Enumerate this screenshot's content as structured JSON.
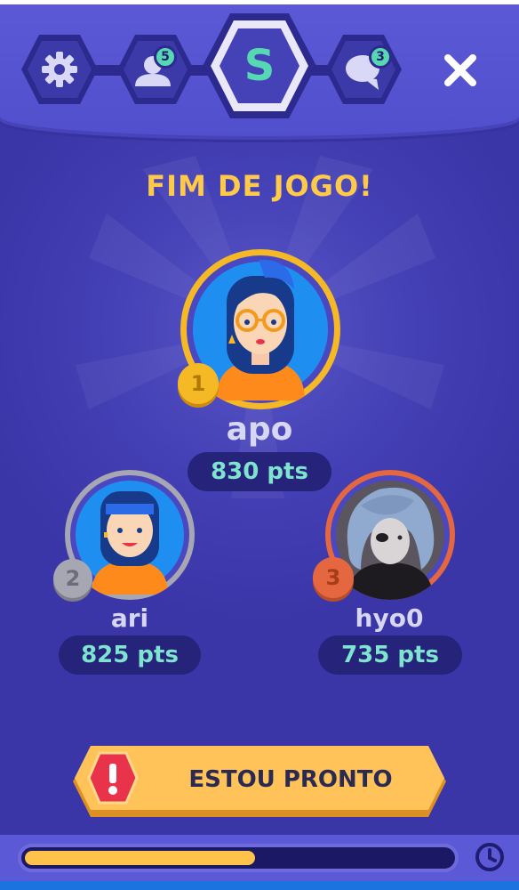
{
  "header": {
    "active_tab_letter": "S",
    "likes_count": "5",
    "chat_count": "3"
  },
  "title": "FIM DE JOGO!",
  "podium": [
    {
      "rank": "1",
      "name": "apo",
      "points": "830 pts",
      "rank_color": "#f5b926"
    },
    {
      "rank": "2",
      "name": "ari",
      "points": "825 pts",
      "rank_color": "#a7a7b3"
    },
    {
      "rank": "3",
      "name": "hyo0",
      "points": "735 pts",
      "rank_color": "#e5673f"
    }
  ],
  "ready_button": {
    "label": "ESTOU PRONTO",
    "icon": "alert-icon"
  },
  "timer": {
    "progress": 0.54,
    "icon": "clock-icon"
  },
  "colors": {
    "background": "#3a36a8",
    "accent_yellow": "#ffc94a",
    "teal": "#56d9b3",
    "button": "#ffc35a",
    "alert_red": "#e8334a"
  }
}
